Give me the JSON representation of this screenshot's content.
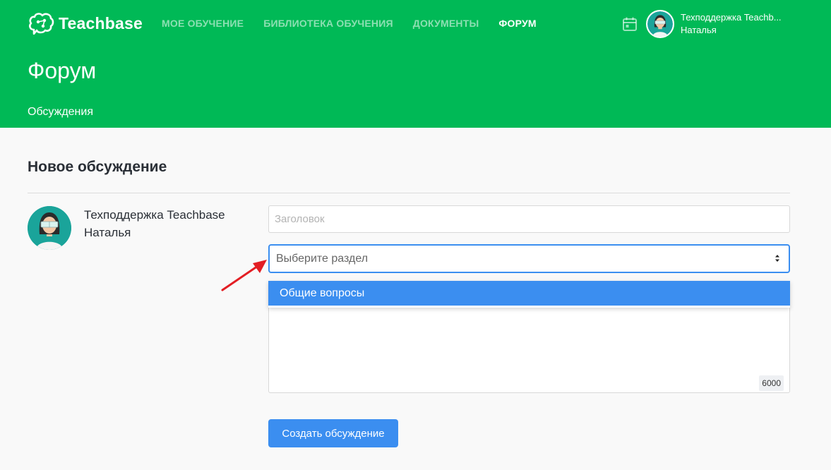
{
  "brand": {
    "name": "Teachbase"
  },
  "nav": {
    "items": [
      {
        "label": "МОЕ ОБУЧЕНИЕ",
        "active": false
      },
      {
        "label": "БИБЛИОТЕКА ОБУЧЕНИЯ",
        "active": false
      },
      {
        "label": "ДОКУМЕНТЫ",
        "active": false
      },
      {
        "label": "ФОРУМ",
        "active": true
      }
    ]
  },
  "user": {
    "name_line1": "Техподдержка Teachb...",
    "name_line2": "Наталья"
  },
  "page": {
    "title": "Форум",
    "subnav": "Обсуждения"
  },
  "form": {
    "heading": "Новое обсуждение",
    "author_line1": "Техподдержка Teachbase",
    "author_line2": "Наталья",
    "title_placeholder": "Заголовок",
    "section_select": "Выберите раздел",
    "section_options": [
      "Общие вопросы"
    ],
    "char_limit": "6000",
    "submit_label": "Создать обсуждение"
  },
  "colors": {
    "header_bg": "#00b956",
    "primary": "#3b8ef0",
    "annotation_arrow": "#e31e24"
  },
  "icons": {
    "brand": "brain-logo-icon",
    "calendar": "calendar-icon",
    "select": "select-arrows-icon",
    "annotation": "red-arrow-annotation"
  }
}
